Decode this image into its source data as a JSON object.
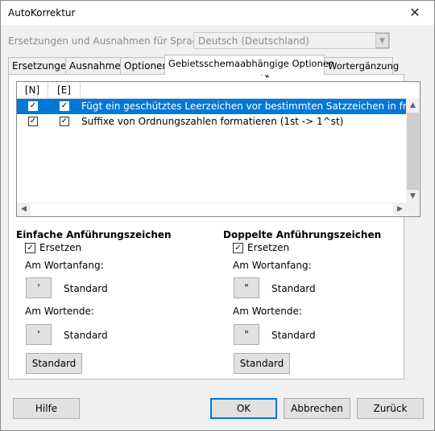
{
  "window": {
    "title": "AutoKorrektur",
    "close_glyph": "✕"
  },
  "language": {
    "label": "Ersetzungen und Ausnahmen für Sprache:",
    "value": "Deutsch (Deutschland)"
  },
  "tabs": [
    {
      "label": "Ersetzungen"
    },
    {
      "label": "Ausnahmen"
    },
    {
      "label": "Optionen"
    },
    {
      "label": "Gebietsschemaabhängige Optionen",
      "active": true
    },
    {
      "label": "Wortergänzung"
    }
  ],
  "options_list": {
    "headers": [
      "[N]",
      "[E]"
    ],
    "rows": [
      {
        "n_checked": true,
        "e_checked": true,
        "text": "Fügt ein geschütztes Leerzeichen vor bestimmten Satzzeichen in französische",
        "selected": true
      },
      {
        "n_checked": true,
        "e_checked": true,
        "text": "Suffixe von Ordnungszahlen formatieren (1st -> 1^st)",
        "selected": false
      }
    ]
  },
  "single_quotes": {
    "title": "Einfache Anführungszeichen",
    "replace_label": "Ersetzen",
    "replace_checked": true,
    "start_label": "Am Wortanfang:",
    "start_char": "'",
    "start_value": "Standard",
    "end_label": "Am Wortende:",
    "end_char": "'",
    "end_value": "Standard",
    "default_button": "Standard"
  },
  "double_quotes": {
    "title": "Doppelte Anführungszeichen",
    "replace_label": "Ersetzen",
    "replace_checked": true,
    "start_label": "Am Wortanfang:",
    "start_char": "\"",
    "start_value": "Standard",
    "end_label": "Am Wortende:",
    "end_char": "\"",
    "end_value": "Standard",
    "default_button": "Standard"
  },
  "footer": {
    "help": "Hilfe",
    "ok": "OK",
    "cancel": "Abbrechen",
    "reset": "Zurück"
  },
  "colors": {
    "selection": "#0078d7",
    "dialog_bg": "#f0f0f0"
  },
  "check_glyph": "✓"
}
